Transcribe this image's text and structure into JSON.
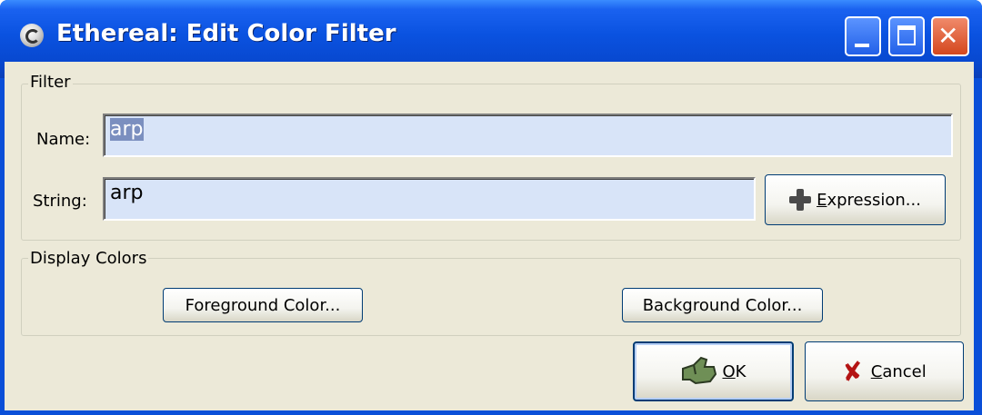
{
  "window": {
    "title": "Ethereal: Edit Color Filter"
  },
  "filter_group": {
    "legend": "Filter",
    "name_label": "Name:",
    "name_value": "arp",
    "string_label": "String:",
    "string_value": "arp",
    "expression_label_mnemonic": "E",
    "expression_label_rest": "xpression..."
  },
  "display_colors": {
    "legend": "Display Colors",
    "foreground_button": "Foreground Color...",
    "background_button": "Background Color..."
  },
  "actions": {
    "ok_mnemonic": "O",
    "ok_rest": "K",
    "cancel_mnemonic": "C",
    "cancel_rest": "ancel"
  },
  "icons": {
    "app": "ethereal-app-icon",
    "expression": "plus-icon",
    "ok": "ok-hand-icon",
    "cancel": "x-icon"
  }
}
